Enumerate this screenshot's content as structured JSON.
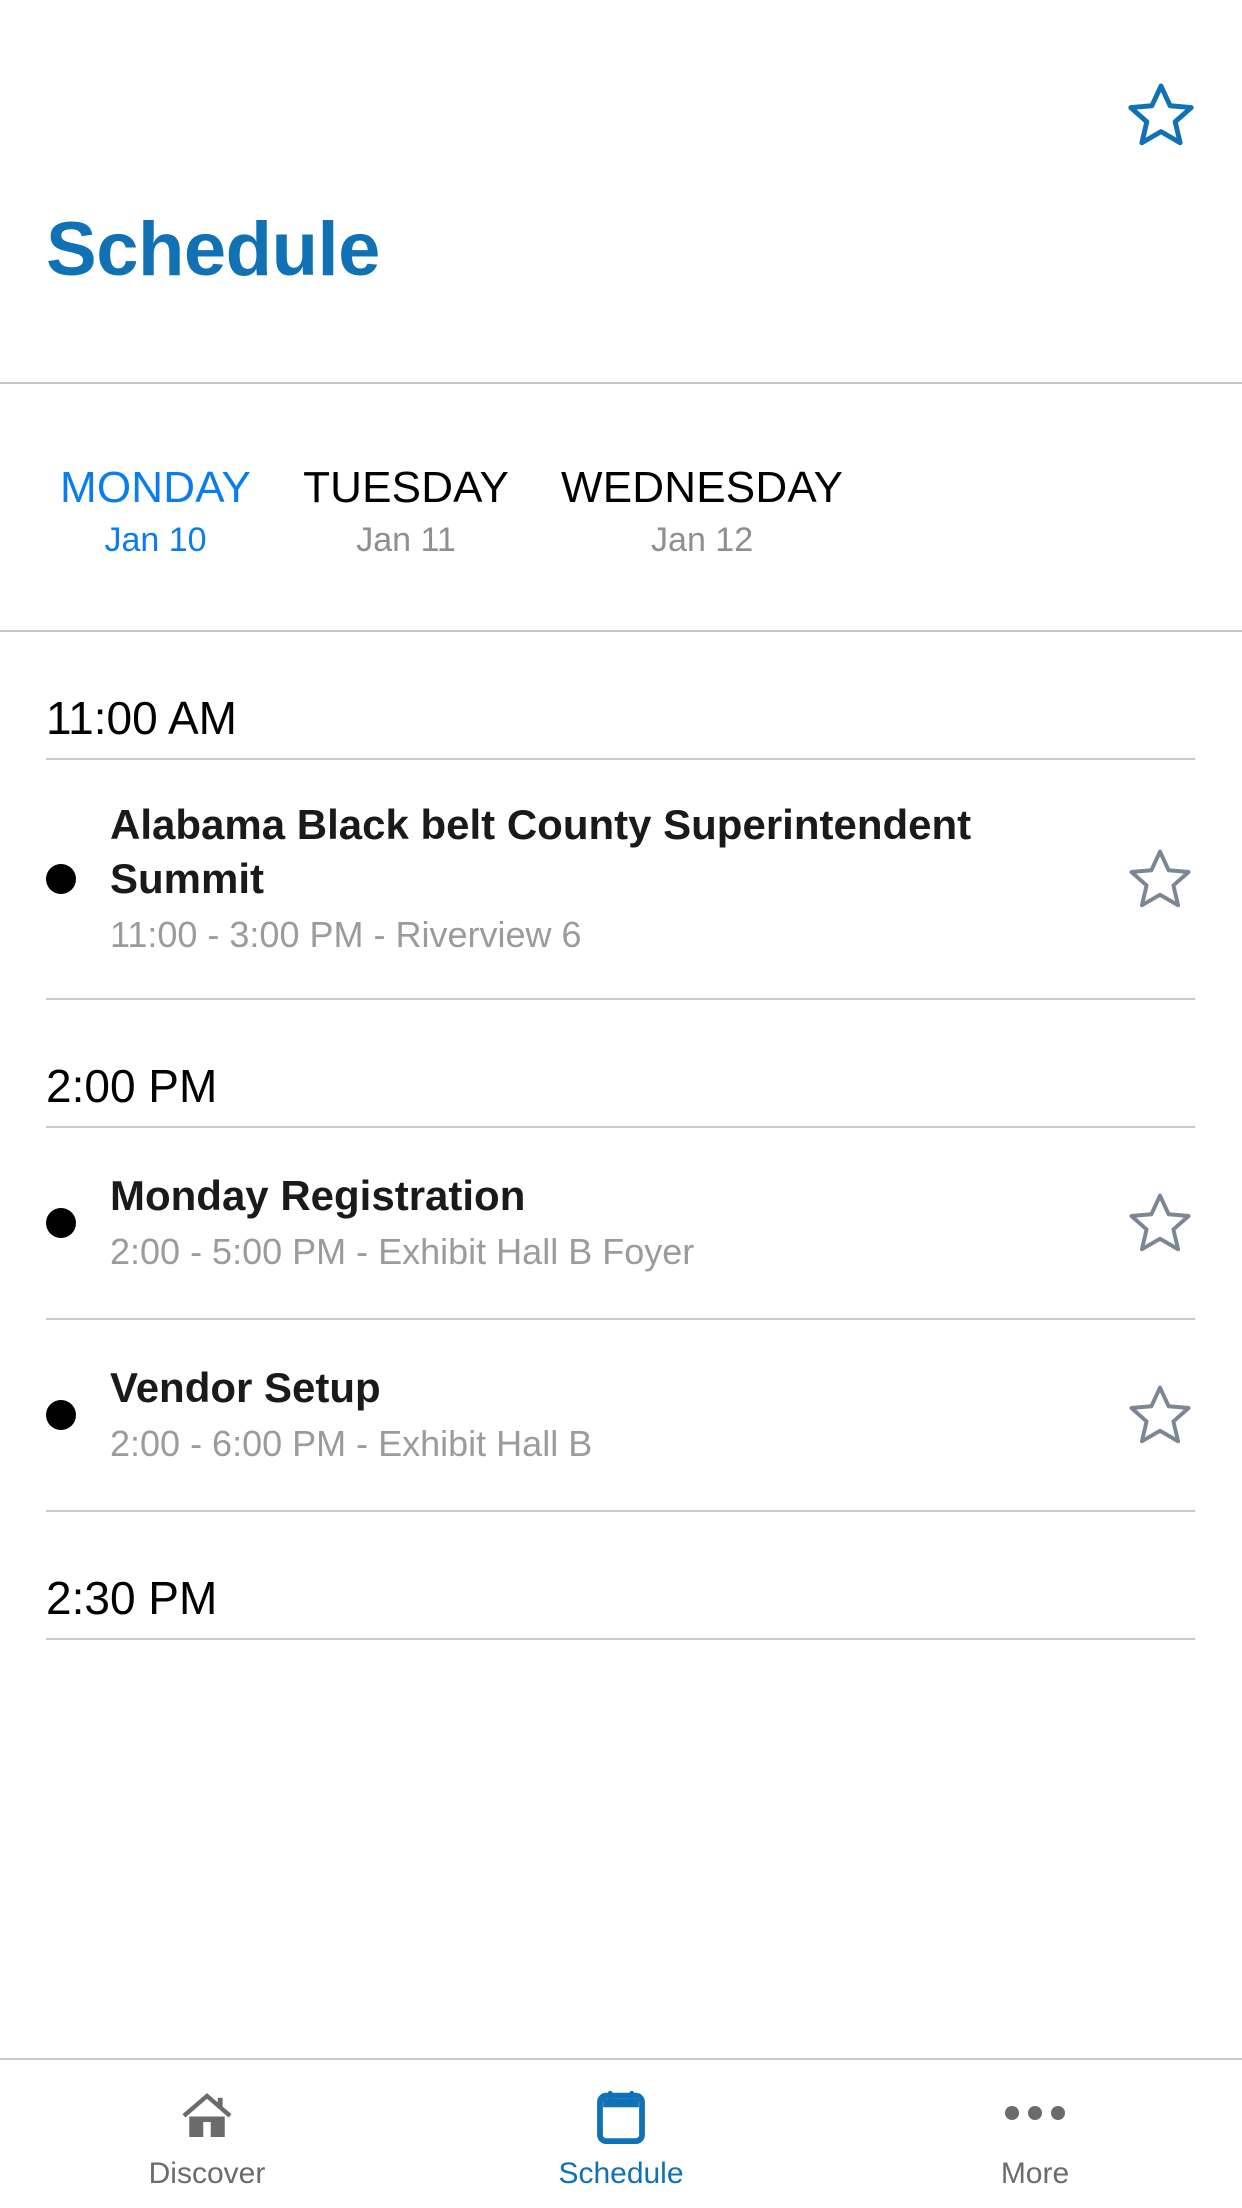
{
  "header": {
    "title": "Schedule",
    "favorite_icon": "star-outline-icon",
    "favorite_color": "#1071b5"
  },
  "day_tabs": {
    "selected_index": 0,
    "items": [
      {
        "day": "MONDAY",
        "date": "Jan 10"
      },
      {
        "day": "TUESDAY",
        "date": "Jan 11"
      },
      {
        "day": "WEDNESDAY",
        "date": "Jan 12"
      }
    ]
  },
  "schedule": {
    "sections": [
      {
        "time": "11:00 AM",
        "events": [
          {
            "title": "Alabama Black belt County Superintendent Summit",
            "meta": "11:00 - 3:00 PM - Riverview 6",
            "star_icon": "star-outline-icon"
          }
        ]
      },
      {
        "time": "2:00 PM",
        "events": [
          {
            "title": "Monday Registration",
            "meta": "2:00 - 5:00 PM - Exhibit Hall B Foyer",
            "star_icon": "star-outline-icon"
          },
          {
            "title": "Vendor Setup",
            "meta": "2:00 - 6:00 PM - Exhibit Hall B",
            "star_icon": "star-outline-icon"
          }
        ]
      },
      {
        "time": "2:30 PM",
        "events": []
      }
    ]
  },
  "tabbar": {
    "active_index": 1,
    "items": [
      {
        "label": "Discover",
        "icon": "home-icon"
      },
      {
        "label": "Schedule",
        "icon": "calendar-icon"
      },
      {
        "label": "More",
        "icon": "ellipsis-icon"
      }
    ]
  },
  "colors": {
    "accent": "#1071b5",
    "tab_selected": "#0a7cf0",
    "muted_text": "#9b9b9b",
    "divider": "#c8c8c8",
    "star_gray": "#7b8794"
  }
}
